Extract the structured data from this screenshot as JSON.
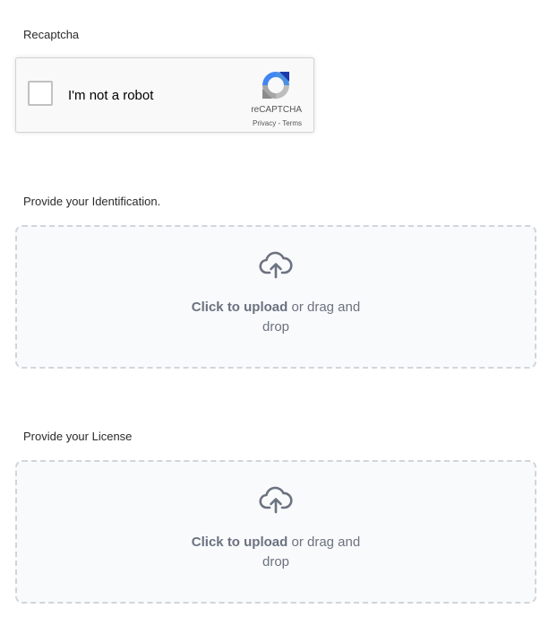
{
  "recaptcha": {
    "label": "Recaptcha",
    "checkbox_text": "I'm not a robot",
    "brand": "reCAPTCHA",
    "privacy": "Privacy",
    "separator": " - ",
    "terms": "Terms"
  },
  "identification": {
    "label": "Provide your Identification.",
    "upload_action": "Click to upload",
    "upload_rest": " or drag and drop",
    "icon": "cloud-upload-icon"
  },
  "license": {
    "label": "Provide your License",
    "upload_action": "Click to upload",
    "upload_rest": " or drag and drop",
    "icon": "cloud-upload-icon"
  },
  "colors": {
    "upload_border": "#d1d5db",
    "upload_bg": "#f9fafb",
    "upload_text": "#6b7280"
  }
}
